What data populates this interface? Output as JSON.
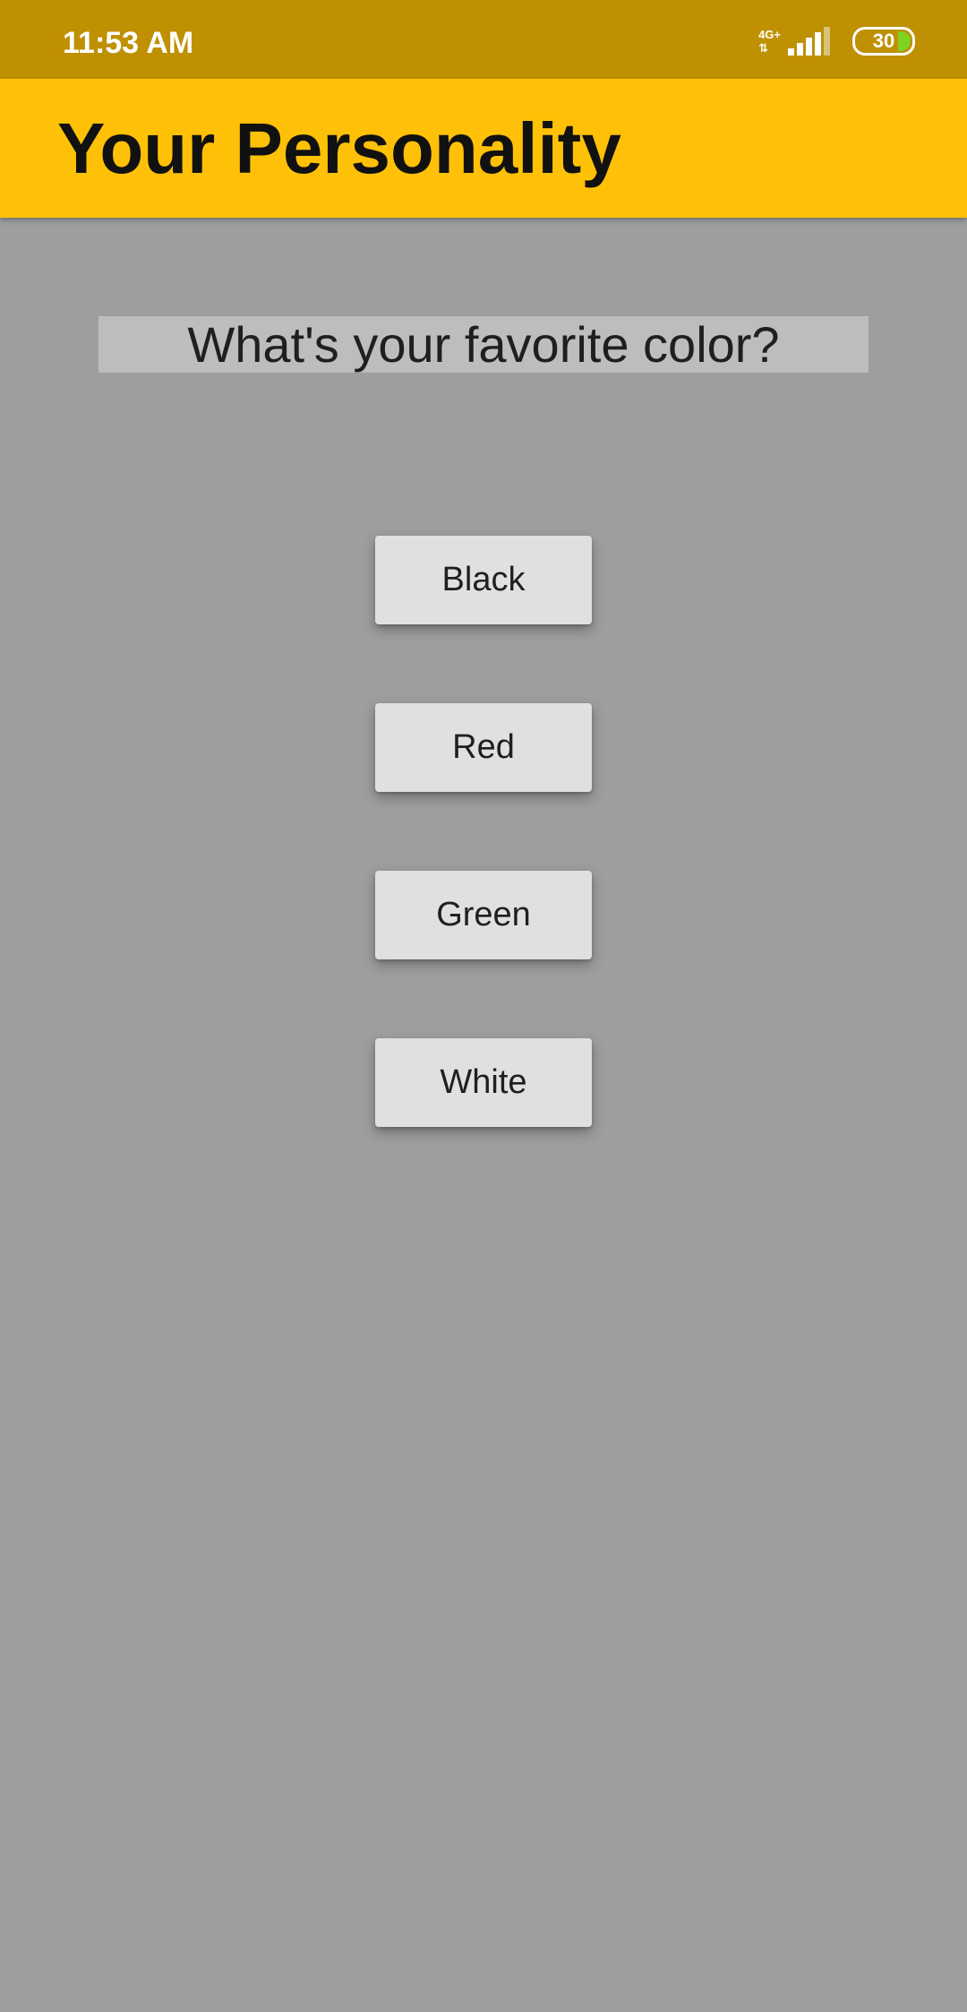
{
  "status_bar": {
    "time": "11:53 AM",
    "network": "4G+",
    "battery": "30",
    "battery_color": "#7ed321"
  },
  "app_bar": {
    "title": "Your Personality",
    "color": "#ffc107"
  },
  "quiz": {
    "question": "What's your favorite color?",
    "options": [
      "Black",
      "Red",
      "Green",
      "White"
    ]
  }
}
